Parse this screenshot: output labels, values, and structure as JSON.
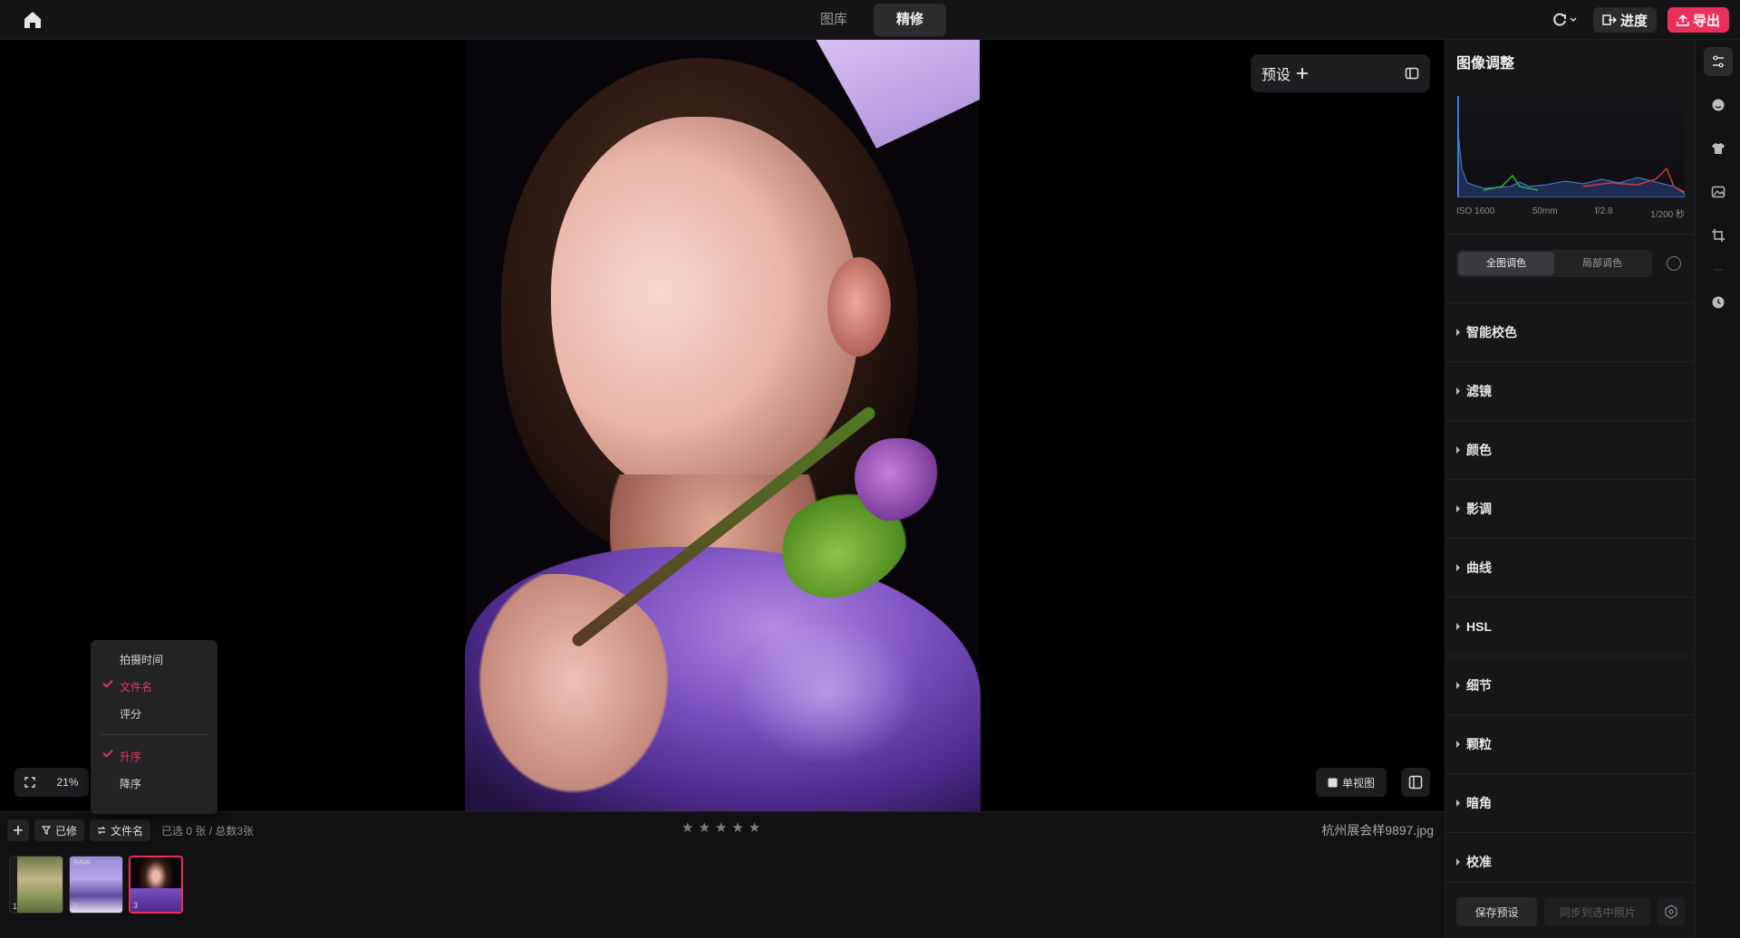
{
  "topbar": {
    "tabs": [
      {
        "label": "图库"
      },
      {
        "label": "精修"
      }
    ],
    "progress_label": "进度",
    "export_label": "导出"
  },
  "canvas": {
    "preset_label": "预设",
    "zoom_level": "21%",
    "single_view_label": "单视图"
  },
  "sort_menu": {
    "items": [
      {
        "label": "拍摄时间",
        "checked": false
      },
      {
        "label": "文件名",
        "checked": true
      },
      {
        "label": "评分",
        "checked": false
      }
    ],
    "order": [
      {
        "label": "升序",
        "checked": true
      },
      {
        "label": "降序",
        "checked": false
      }
    ]
  },
  "bottom": {
    "filter_label": "已修",
    "sort_label": "文件名",
    "count_text": "已选 0 张 / 总数3张",
    "rating_stars": 5,
    "filename": "杭州展会样9897.jpg",
    "thumbnails": [
      {
        "number": "1",
        "tag": "",
        "selected": false
      },
      {
        "number": "2",
        "tag": "RAW",
        "selected": false
      },
      {
        "number": "3",
        "tag": "",
        "selected": true
      }
    ]
  },
  "right_panel": {
    "title": "图像调整",
    "exif": {
      "iso": "ISO 1600",
      "focal": "50mm",
      "aperture": "f/2.8",
      "shutter": "1/200 秒"
    },
    "segment": {
      "global": "全图调色",
      "local": "局部调色"
    },
    "sections": [
      {
        "label": "智能校色"
      },
      {
        "label": "滤镜"
      },
      {
        "label": "颜色"
      },
      {
        "label": "影调"
      },
      {
        "label": "曲线"
      },
      {
        "label": "HSL"
      },
      {
        "label": "细节"
      },
      {
        "label": "颗粒"
      },
      {
        "label": "暗角"
      },
      {
        "label": "校准"
      }
    ],
    "save_preset_label": "保存预设",
    "sync_label": "同步到选中照片"
  },
  "colors": {
    "accent": "#e8315a",
    "panel_bg": "#161618",
    "canvas_bg": "#000000"
  },
  "icons": {
    "toolbar": [
      "adjust-icon",
      "face-icon",
      "clothing-icon",
      "image-icon",
      "crop-icon",
      "history-icon"
    ]
  }
}
